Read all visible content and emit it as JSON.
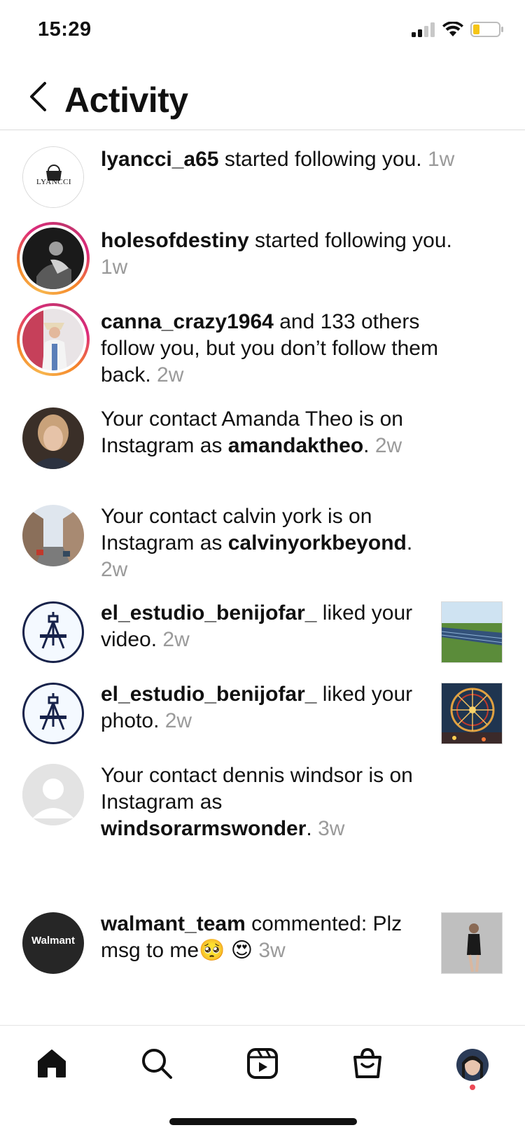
{
  "status_bar": {
    "time": "15:29",
    "icons": [
      "signal-icon",
      "wifi-icon",
      "battery-icon"
    ]
  },
  "header": {
    "title": "Activity",
    "back_icon": "chevron-left-icon"
  },
  "activities": [
    {
      "username": "lyancci_a65",
      "text": " started following you. ",
      "time": "1w",
      "avatar": "lyancci-logo",
      "story_ring": false,
      "thumbnail": null
    },
    {
      "username": "holesofdestiny",
      "text": " started following you. ",
      "time": "1w",
      "avatar": "photo-bw",
      "story_ring": true,
      "thumbnail": null
    },
    {
      "username": "canna_crazy1964",
      "text": " and 133 others follow you, but you don’t follow them back. ",
      "time": "2w",
      "avatar": "photo-woman-hat",
      "story_ring": true,
      "thumbnail": null
    },
    {
      "prefix": "Your contact Amanda Theo is on Instagram as ",
      "username": "amandaktheo",
      "suffix": ". ",
      "time": "2w",
      "avatar": "photo-woman",
      "story_ring": false,
      "thumbnail": null
    },
    {
      "prefix": "Your contact calvin york is on Instagram as ",
      "username": "calvinyorkbeyond",
      "suffix": ". ",
      "time": "2w",
      "avatar": "photo-street",
      "story_ring": false,
      "thumbnail": null
    },
    {
      "username": "el_estudio_benijofar_",
      "text": " liked your video. ",
      "time": "2w",
      "avatar": "easel-logo",
      "story_ring": false,
      "thumbnail": "solar-field"
    },
    {
      "username": "el_estudio_benijofar_",
      "text": " liked your photo. ",
      "time": "2w",
      "avatar": "easel-logo",
      "story_ring": false,
      "thumbnail": "ferris-wheel"
    },
    {
      "prefix": "Your contact dennis windsor is on Instagram as ",
      "username": "windsorarmswonder",
      "suffix": ". ",
      "time": "3w",
      "avatar": "default-avatar",
      "story_ring": false,
      "thumbnail": null
    },
    {
      "username": "walmant_team",
      "text": " commented: Plz msg to me",
      "emoji": "🥺 😍 ",
      "time": "3w",
      "avatar": "walmant-logo",
      "story_ring": false,
      "thumbnail": "woman-photo"
    }
  ],
  "logos": {
    "lyancci": "LYANCCI",
    "walmant": "Walmant"
  },
  "bottom_nav": {
    "items": [
      "home-icon",
      "search-icon",
      "reels-icon",
      "shop-icon",
      "profile-avatar"
    ],
    "accent": "#ed4956"
  },
  "colors": {
    "username": "#111111",
    "timestamp": "#9a9a9a",
    "divider": "#dbdbdb"
  }
}
